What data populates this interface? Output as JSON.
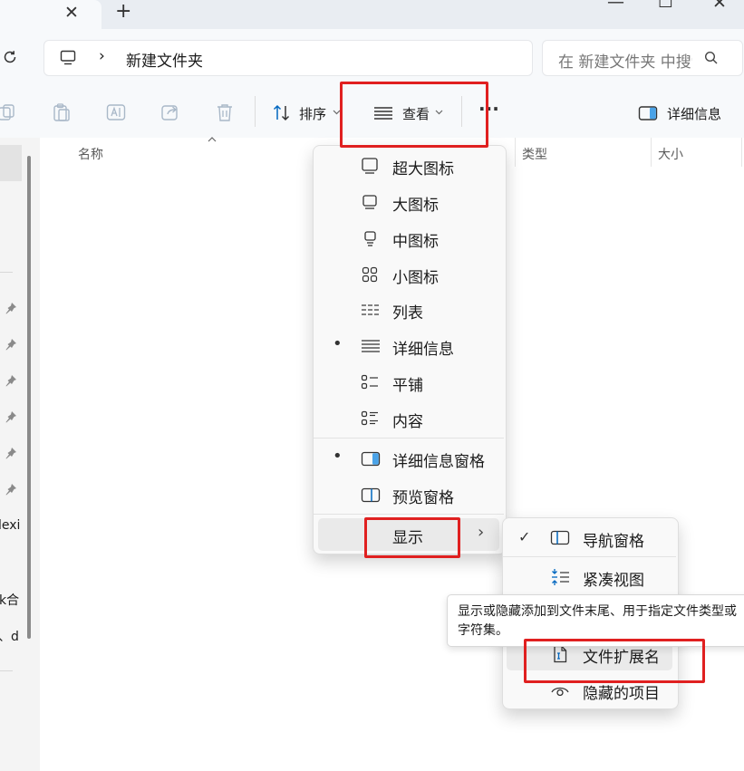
{
  "window": {
    "close_tab_glyph": "✕",
    "new_tab_glyph": "+",
    "minimize_glyph": "—",
    "maximize_glyph": "☐",
    "close_glyph": "✕"
  },
  "address": {
    "breadcrumb_sep": "›",
    "path": "新建文件夹",
    "search_placeholder": "在 新建文件夹 中搜索"
  },
  "toolbar": {
    "sort_label": "排序",
    "view_label": "查看",
    "more_label": "···",
    "details_label": "详细信息"
  },
  "columns": {
    "name": "名称",
    "type": "类型",
    "size": "大小"
  },
  "nav_fragments": [
    "lexi",
    "k合",
    "、d"
  ],
  "view_menu": {
    "items": [
      {
        "label": "超大图标",
        "icon": "extra-large-icons-icon",
        "selected": false
      },
      {
        "label": "大图标",
        "icon": "large-icons-icon",
        "selected": false
      },
      {
        "label": "中图标",
        "icon": "medium-icons-icon",
        "selected": false
      },
      {
        "label": "小图标",
        "icon": "small-icons-icon",
        "selected": false
      },
      {
        "label": "列表",
        "icon": "list-icon",
        "selected": false
      },
      {
        "label": "详细信息",
        "icon": "details-icon",
        "selected": true
      },
      {
        "label": "平铺",
        "icon": "tiles-icon",
        "selected": false
      },
      {
        "label": "内容",
        "icon": "content-icon",
        "selected": false
      }
    ],
    "panes": [
      {
        "label": "详细信息窗格",
        "icon": "details-pane-icon",
        "selected": true
      },
      {
        "label": "预览窗格",
        "icon": "preview-pane-icon",
        "selected": false
      }
    ],
    "show_label": "显示",
    "selected_bullet": "•",
    "submenu_chevron": "›"
  },
  "show_submenu": {
    "items": [
      {
        "label": "导航窗格",
        "icon": "navigation-pane-icon",
        "checked": true
      },
      {
        "label": "紧凑视图",
        "icon": "compact-view-icon",
        "checked": false
      },
      {
        "label": "文件扩展名",
        "icon": "file-extension-icon",
        "checked": false
      },
      {
        "label": "隐藏的项目",
        "icon": "hidden-items-icon",
        "checked": false
      }
    ],
    "check_glyph": "✓"
  },
  "tooltip": {
    "line1": "显示或隐藏添加到文件末尾、用于指定文件类型或",
    "line2": "字符集。"
  },
  "colors": {
    "accent": "#0067c0",
    "callout": "#e02020"
  }
}
